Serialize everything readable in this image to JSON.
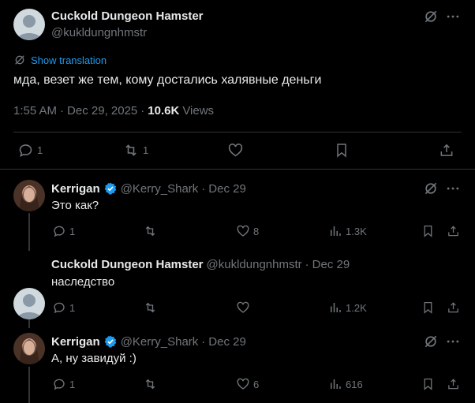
{
  "colors": {
    "background": "#000000",
    "text": "#e7e9ea",
    "muted": "#71767b",
    "link": "#1d9bf0",
    "verified": "#1d9bf0",
    "divider": "#2f3336"
  },
  "main_post": {
    "author_name": "Cuckold Dungeon Hamster",
    "author_handle": "@kukldungnhmstr",
    "show_translation": "Show translation",
    "text": "мда, везет же тем, кому достались халявные деньги",
    "time": "1:55 AM",
    "sep1": "·",
    "date": "Dec 29, 2025",
    "sep2": "·",
    "views_count": "10.6K",
    "views_label": "Views",
    "actions": {
      "replies": "1",
      "reposts": "1",
      "likes": "",
      "bookmarks": ""
    }
  },
  "replies": [
    {
      "author_name": "Kerrigan",
      "verified": true,
      "author_handle": "@Kerry_Shark",
      "sep": "·",
      "date": "Dec 29",
      "text": "Это как?",
      "actions": {
        "replies": "1",
        "reposts": "",
        "likes": "8",
        "views": "1.3K"
      }
    },
    {
      "author_name": "Cuckold Dungeon Hamster",
      "verified": false,
      "author_handle": "@kukldungnhmstr",
      "sep": "·",
      "date": "Dec 29",
      "text": "наследство",
      "actions": {
        "replies": "1",
        "reposts": "",
        "likes": "",
        "views": "1.2K"
      }
    },
    {
      "author_name": "Kerrigan",
      "verified": true,
      "author_handle": "@Kerry_Shark",
      "sep": "·",
      "date": "Dec 29",
      "text": "А, ну завидуй :)",
      "actions": {
        "replies": "1",
        "reposts": "",
        "likes": "6",
        "views": "616"
      }
    }
  ]
}
